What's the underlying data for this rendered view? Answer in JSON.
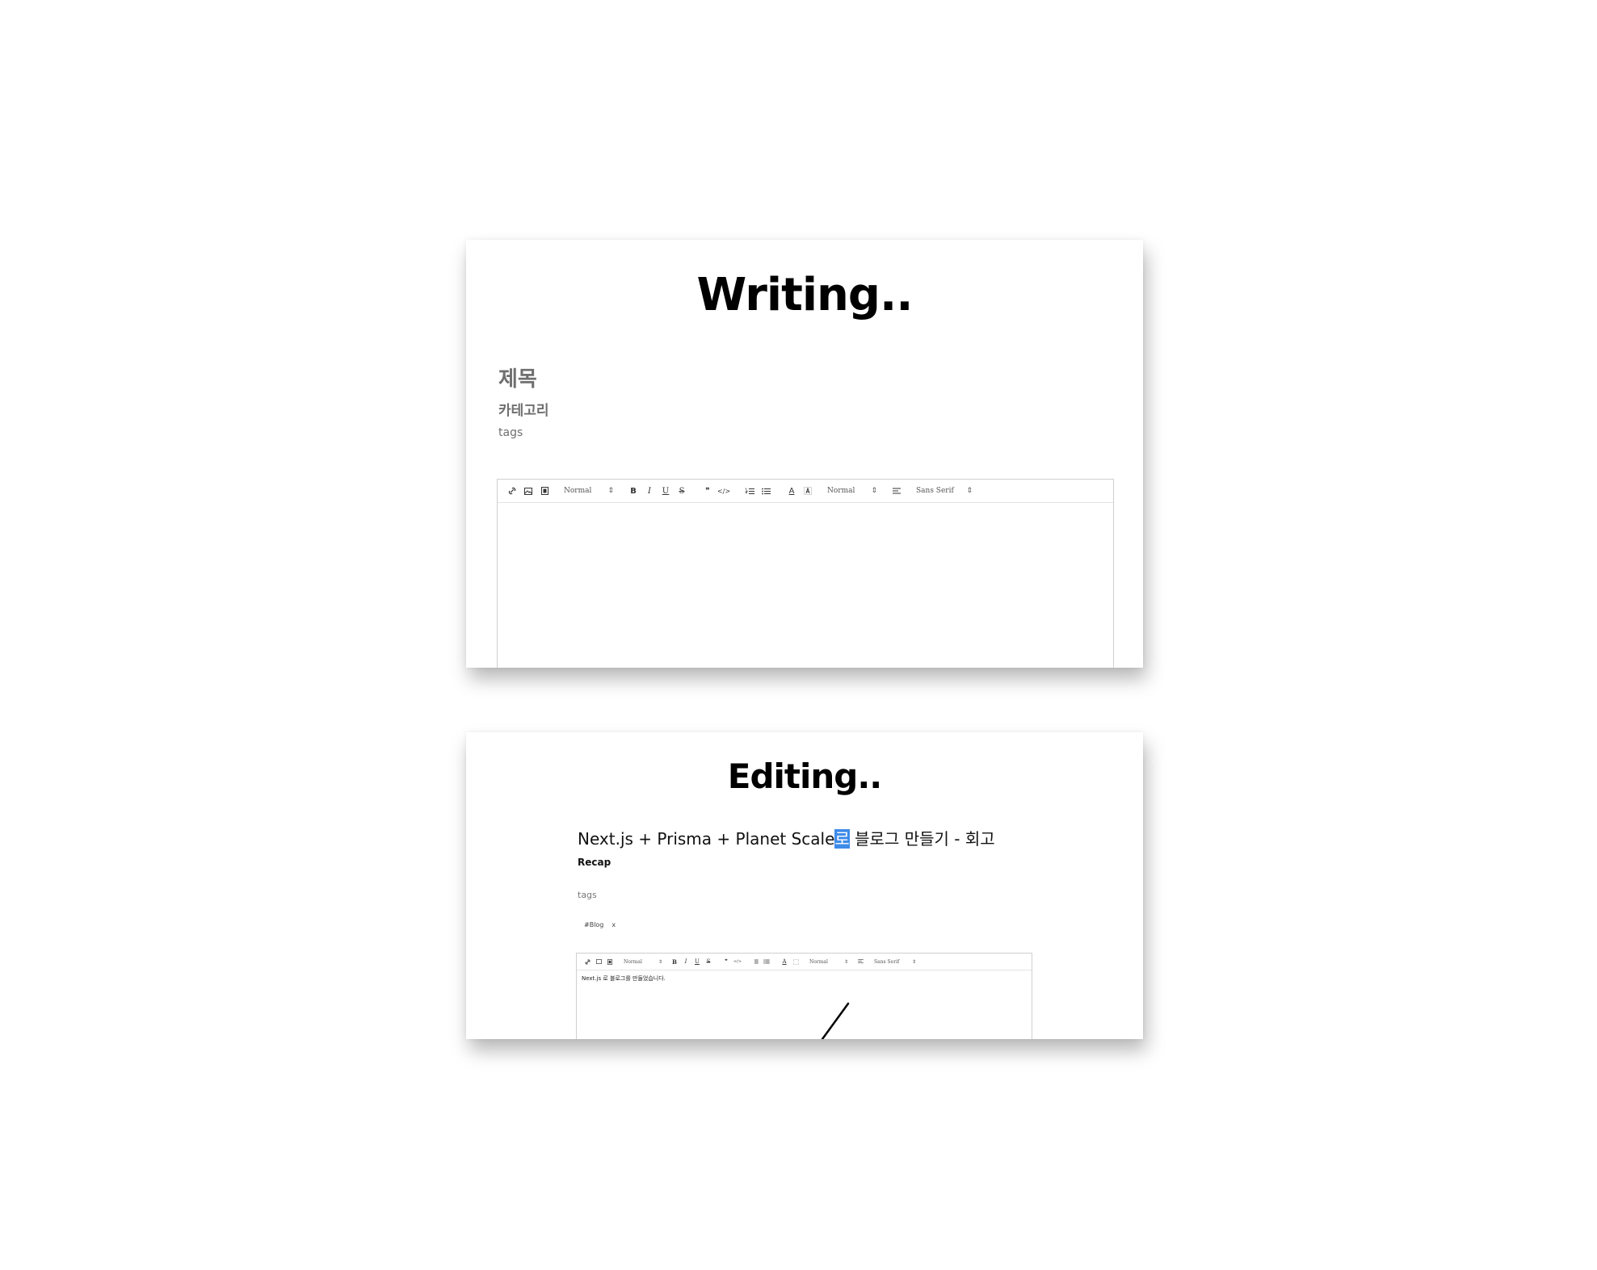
{
  "writing": {
    "heading": "Writing..",
    "title_placeholder": "제목",
    "category_placeholder": "카테고리",
    "tags_placeholder": "tags",
    "toolbar": {
      "header_select": "Normal",
      "size_select": "Normal",
      "font_select": "Sans Serif",
      "icons": [
        "link-icon",
        "image-icon",
        "video-icon",
        "bold-icon",
        "italic-icon",
        "underline-icon",
        "strike-icon",
        "blockquote-icon",
        "code-block-icon",
        "ordered-list-icon",
        "bullet-list-icon",
        "text-color-icon",
        "background-color-icon",
        "align-icon"
      ]
    }
  },
  "editing": {
    "heading": "Editing..",
    "title_before": "Next.js + Prisma + Planet Scale",
    "title_selected": "로",
    "title_after": " 블로그 만들기 - 회고",
    "category": "Recap",
    "tags_label": "tags",
    "tag_chip": "#Blog",
    "tag_remove": "x",
    "body_text": "Next.js 로 블로그를 만들었습니다.",
    "toolbar": {
      "header_select": "Normal",
      "size_select": "Normal",
      "font_select": "Sans Serif"
    }
  },
  "glyphs": {
    "bold": "B",
    "italic": "I",
    "underline": "U",
    "strike": "S",
    "quote": "❞",
    "code": "</>",
    "caret": "⇕",
    "color": "A"
  }
}
